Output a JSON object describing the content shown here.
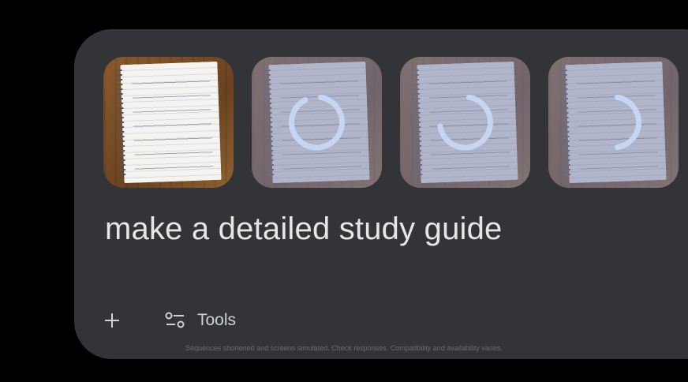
{
  "images": [
    {
      "name": "notes-photo-1",
      "state": "loaded",
      "progress": 1.0
    },
    {
      "name": "notes-photo-2",
      "state": "uploading",
      "progress": 0.9
    },
    {
      "name": "notes-photo-3",
      "state": "uploading",
      "progress": 0.7
    },
    {
      "name": "notes-photo-4",
      "state": "uploading",
      "progress": 0.45
    }
  ],
  "prompt": {
    "text": "make a detailed study guide"
  },
  "toolbar": {
    "plus_icon": "plus-icon",
    "tools_icon": "tools-sliders-icon",
    "tools_label": "Tools"
  },
  "disclaimer": "Sequences shortened and screens simulated. Check responses. Compatibility and availability varies.",
  "colors": {
    "background": "#000000",
    "card": "#323437",
    "spinner": "#c6d5f2",
    "text": "#e6e6e6"
  }
}
